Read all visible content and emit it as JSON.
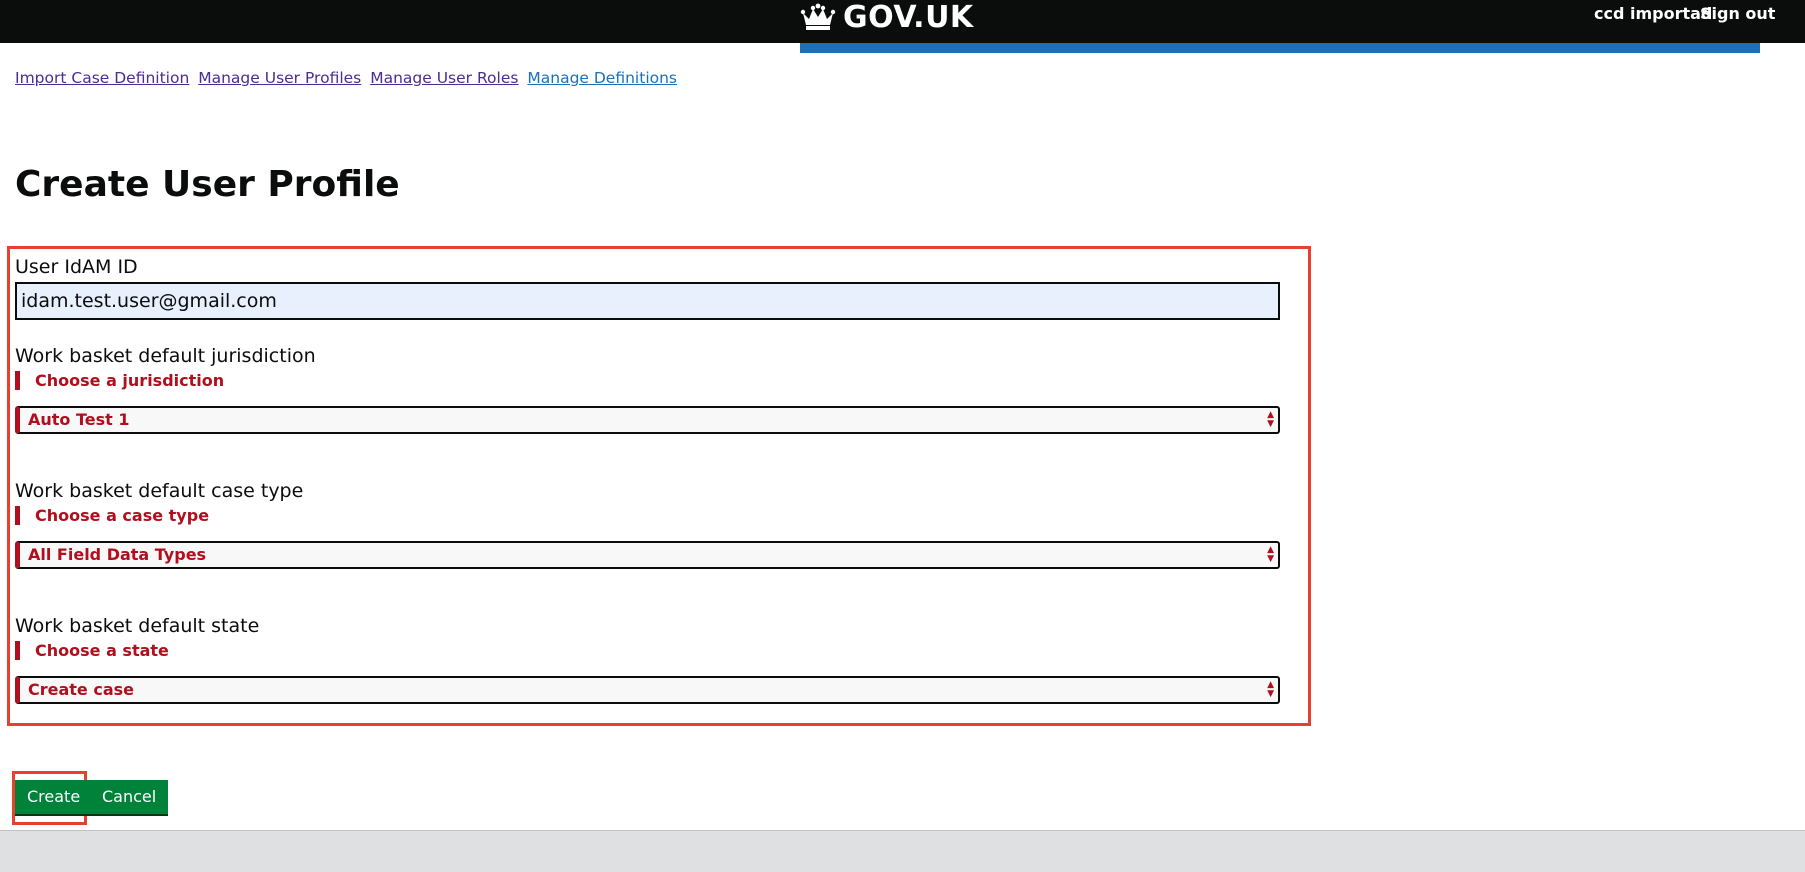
{
  "header": {
    "brand": "GOV.UK",
    "user_name": "ccd importad",
    "sign_out": "Sign out"
  },
  "nav": {
    "links": [
      "Import Case Definition",
      "Manage User Profiles",
      "Manage User Roles",
      "Manage Definitions"
    ]
  },
  "page": {
    "title": "Create User Profile"
  },
  "form": {
    "idam": {
      "label": "User IdAM ID",
      "value": "idam.test.user@gmail.com"
    },
    "jurisdiction": {
      "label": "Work basket default jurisdiction",
      "error": "Choose a jurisdiction",
      "selected": "Auto Test 1"
    },
    "case_type": {
      "label": "Work basket default case type",
      "error": "Choose a case type",
      "selected": "All Field Data Types"
    },
    "state": {
      "label": "Work basket default state",
      "error": "Choose a state",
      "selected": "Create case"
    }
  },
  "buttons": {
    "create": "Create",
    "cancel": "Cancel"
  },
  "colors": {
    "header_bg": "#0b0c0c",
    "brand_bar": "#1d70b8",
    "error": "#b10e1e",
    "button": "#00823b",
    "highlight": "#e8402f"
  }
}
